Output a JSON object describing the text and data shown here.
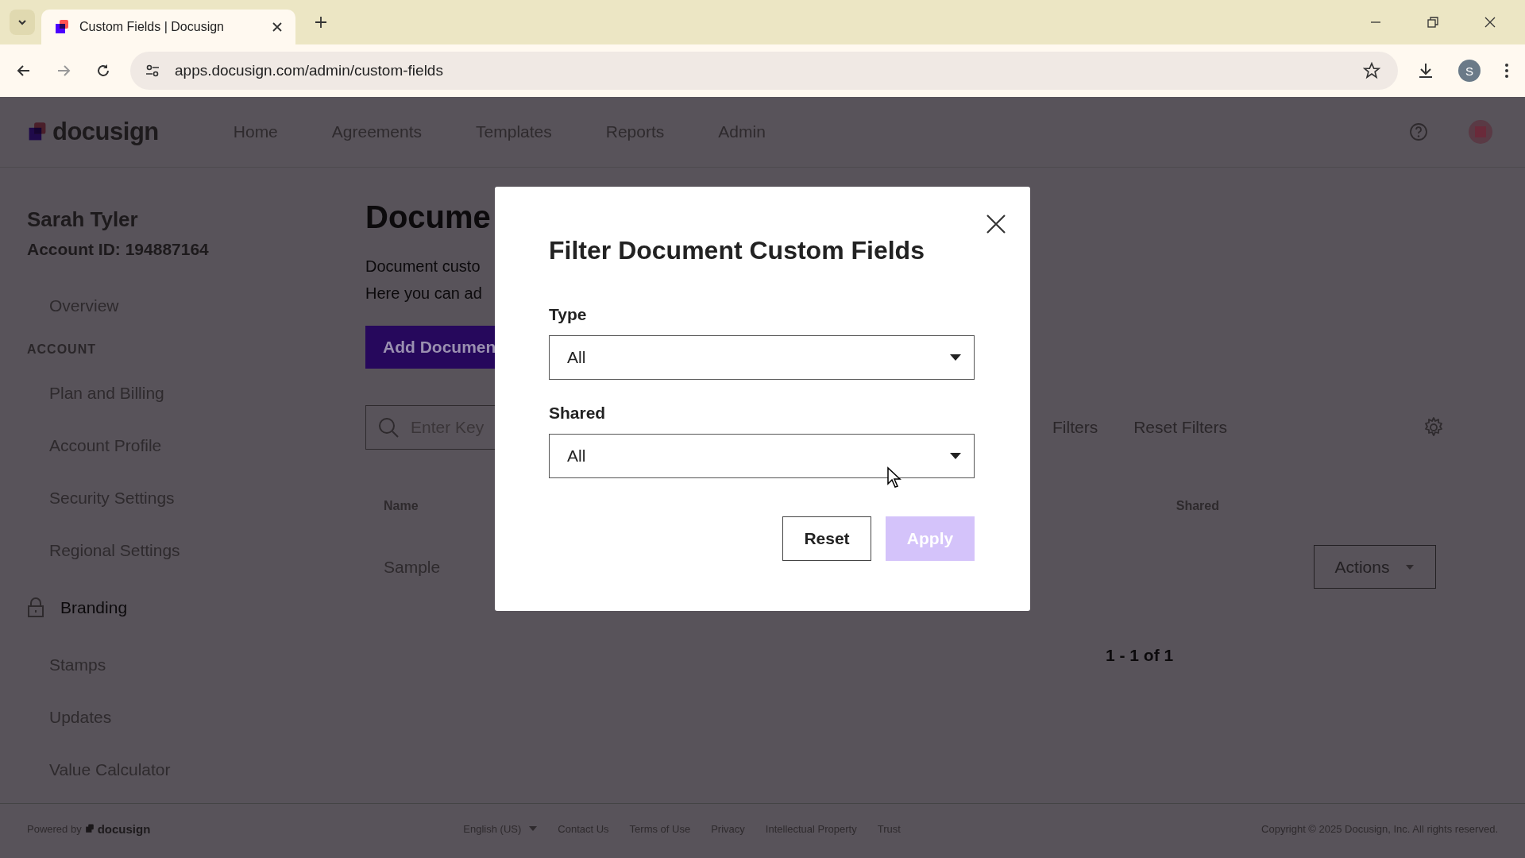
{
  "browser": {
    "tab_title": "Custom Fields | Docusign",
    "url": "apps.docusign.com/admin/custom-fields",
    "profile_letter": "S"
  },
  "header": {
    "logo": "docusign",
    "nav": [
      "Home",
      "Agreements",
      "Templates",
      "Reports",
      "Admin"
    ]
  },
  "sidebar": {
    "user_name": "Sarah Tyler",
    "account_id": "Account ID: 194887164",
    "items": [
      {
        "label": "Overview",
        "kind": "link"
      },
      {
        "label": "ACCOUNT",
        "kind": "heading"
      },
      {
        "label": "Plan and Billing",
        "kind": "link"
      },
      {
        "label": "Account Profile",
        "kind": "link"
      },
      {
        "label": "Security Settings",
        "kind": "link"
      },
      {
        "label": "Regional Settings",
        "kind": "link"
      },
      {
        "label": "Branding",
        "kind": "locked"
      },
      {
        "label": "Stamps",
        "kind": "link"
      },
      {
        "label": "Updates",
        "kind": "link"
      },
      {
        "label": "Value Calculator",
        "kind": "link"
      }
    ]
  },
  "main": {
    "title": "Docume",
    "description": [
      "Document custo",
      "Here you can ad"
    ],
    "add_button": "Add Documen",
    "search_placeholder": "Enter Key",
    "filters": "Filters",
    "reset_filters": "Reset Filters",
    "columns": [
      "Name",
      "Shared"
    ],
    "rows": [
      {
        "name": "Sample",
        "action": "Actions"
      }
    ],
    "pagination": "1 - 1 of 1"
  },
  "modal": {
    "title": "Filter Document Custom Fields",
    "fields": [
      {
        "label": "Type",
        "value": "All"
      },
      {
        "label": "Shared",
        "value": "All"
      }
    ],
    "buttons": [
      {
        "label": "Reset",
        "kind": "secondary",
        "disabled": false
      },
      {
        "label": "Apply",
        "kind": "primary",
        "disabled": true
      }
    ]
  },
  "footer": {
    "powered_by": "Powered by",
    "logo": "docusign",
    "language": "English (US)",
    "links": [
      "Contact Us",
      "Terms of Use",
      "Privacy",
      "Intellectual Property",
      "Trust"
    ],
    "copyright": "Copyright © 2025 Docusign, Inc. All rights reserved."
  }
}
